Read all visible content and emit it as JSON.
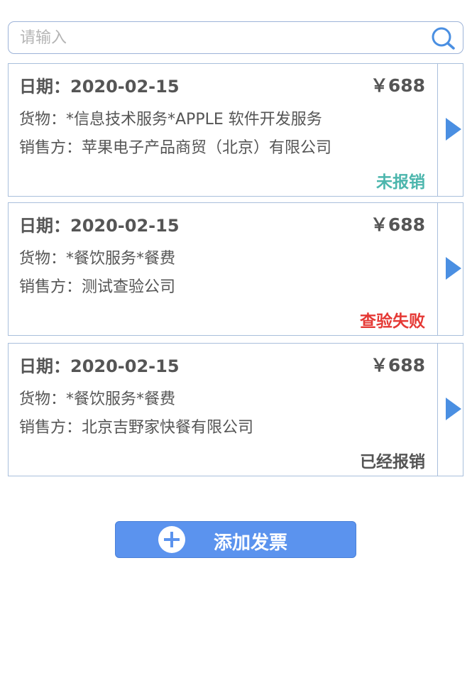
{
  "search": {
    "placeholder": "请输入",
    "value": ""
  },
  "invoices": [
    {
      "date": "日期：2020-02-15",
      "amount": "￥688",
      "goods": "货物：*信息技术服务*APPLE 软件开发服务",
      "seller": "销售方：苹果电子产品商贸（北京）有限公司",
      "status": "未报销",
      "status_color": "#4cb6ad"
    },
    {
      "date": "日期：2020-02-15",
      "amount": "￥688",
      "goods": "货物：*餐饮服务*餐费",
      "seller": "销售方：测试查验公司",
      "status": "查验失败",
      "status_color": "#e53935"
    },
    {
      "date": "日期：2020-02-15",
      "amount": "￥688",
      "goods": "货物：*餐饮服务*餐费",
      "seller": "销售方：北京吉野家快餐有限公司",
      "status": "已经报销",
      "status_color": "#555555"
    }
  ],
  "add_button": {
    "label": "添加发票",
    "icon": "plus-circle-icon"
  },
  "colors": {
    "accent": "#5b93ee",
    "arrow": "#4a8fe2",
    "border": "#a9bfdc"
  }
}
